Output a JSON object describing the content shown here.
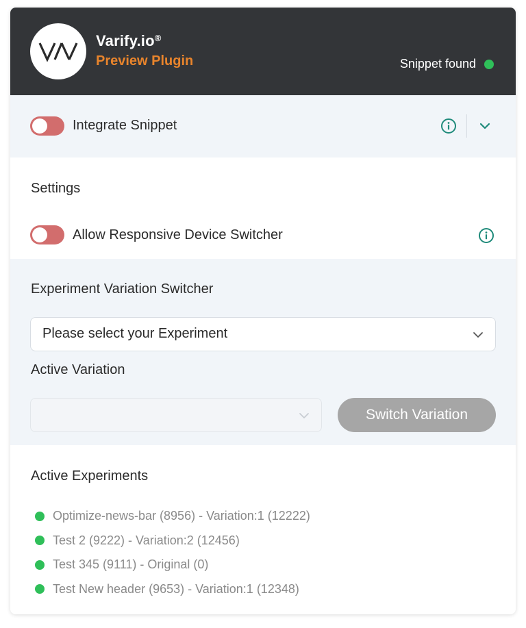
{
  "header": {
    "brand_name": "Varify.io",
    "brand_mark": "®",
    "brand_sub": "Preview Plugin",
    "logo_text": "V/A",
    "snippet_status": "Snippet found",
    "status_color": "#2fbf59"
  },
  "integrate": {
    "label": "Integrate Snippet",
    "enabled": false,
    "info_icon": "info-circle-icon",
    "expand_icon": "chevron-down-icon"
  },
  "settings": {
    "title": "Settings",
    "device_switcher_label": "Allow Responsive Device Switcher",
    "device_switcher_enabled": false
  },
  "switcher": {
    "title": "Experiment Variation Switcher",
    "experiment_select_value": "Please select your Experiment",
    "active_variation_title": "Active Variation",
    "active_variation_value": "",
    "switch_button": "Switch Variation"
  },
  "active_experiments": {
    "title": "Active Experiments",
    "items": [
      "Optimize-news-bar (8956) - Variation:1 (12222)",
      "Test 2 (9222) - Variation:2 (12456)",
      "Test 345 (9111) - Original (0)",
      "Test New header (9653) - Variation:1 (12348)"
    ]
  },
  "colors": {
    "accent_orange": "#e8842c",
    "toggle_off": "#d26d6d",
    "teal_icon": "#1e8a7a",
    "active_green": "#2fbf59",
    "header_bg": "#333538"
  }
}
